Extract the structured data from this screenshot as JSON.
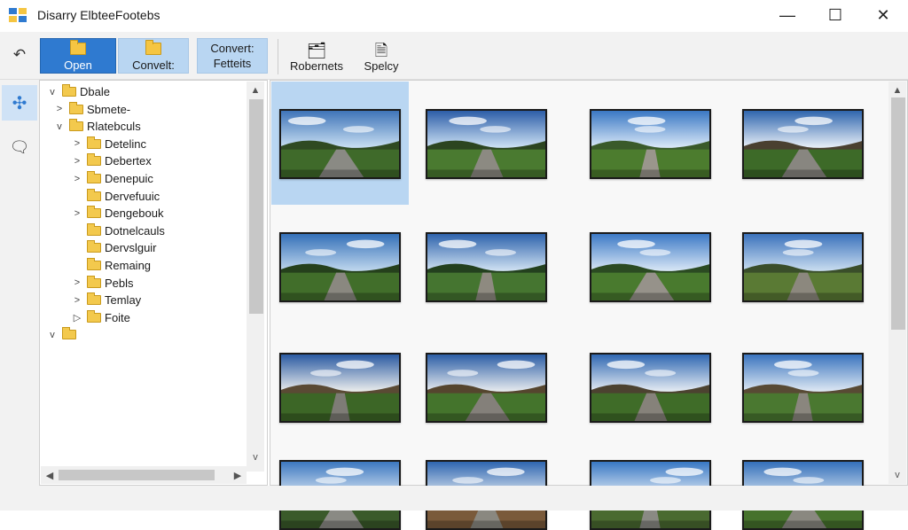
{
  "window": {
    "title": "Disarry ElbteeFootebs",
    "minimize_glyph": "—",
    "maximize_glyph": "☐",
    "close_glyph": "✕"
  },
  "toolbar": {
    "back_icon": "↶",
    "open_label": "Open",
    "convert_label": "Convelt:",
    "convert_fetteis_line1": "Convert:",
    "convert_fetteis_line2": "Fetteits",
    "roberets_label": "Robernets",
    "spelcy_label": "Spelcy",
    "roberets_icon": "🗂",
    "spelcy_icon": "🗎"
  },
  "rail": {
    "pin_icon": "✣",
    "chat_icon": "🗨"
  },
  "tree": {
    "items": [
      {
        "label": "Dbale",
        "chevron": "v",
        "indent": 0
      },
      {
        "label": "Sbmete-",
        "chevron": ">",
        "indent": 1
      },
      {
        "label": "Rlatebculs",
        "chevron": "v",
        "indent": 1
      },
      {
        "label": "Detelinc",
        "chevron": ">",
        "indent": 2
      },
      {
        "label": "Debertex",
        "chevron": ">",
        "indent": 2
      },
      {
        "label": "Denepuic",
        "chevron": ">",
        "indent": 2
      },
      {
        "label": "Dervefuuic",
        "chevron": "",
        "indent": 2
      },
      {
        "label": "Dengebouk",
        "chevron": ">",
        "indent": 2
      },
      {
        "label": "Dotnelcauls",
        "chevron": "",
        "indent": 2
      },
      {
        "label": "Dervslguir",
        "chevron": "",
        "indent": 2
      },
      {
        "label": "Remaing",
        "chevron": "",
        "indent": 2
      },
      {
        "label": "Pebls",
        "chevron": ">",
        "indent": 2
      },
      {
        "label": "Temlay",
        "chevron": ">",
        "indent": 2
      },
      {
        "label": "Foite",
        "chevron": "▷",
        "indent": 2
      },
      {
        "label": "",
        "chevron": "v",
        "indent": 0
      }
    ],
    "scroll_up": "▲",
    "scroll_down": "v",
    "scroll_left": "◀",
    "scroll_right": "▶"
  },
  "gallery": {
    "thumbnails": [
      {
        "sky": "#3f74b8",
        "horizon": "#cfe4f5",
        "ground": "#3f6a2a",
        "hill": "#2f4a22",
        "road": "#8a8a84"
      },
      {
        "sky": "#2d5ea8",
        "horizon": "#d5e8f8",
        "ground": "#4a7a30",
        "hill": "#2c4520",
        "road": "#8c8a82"
      },
      {
        "sky": "#3a78c4",
        "horizon": "#e2eefa",
        "ground": "#4c7c2e",
        "hill": "#3a5a2a",
        "road": "#9a968c"
      },
      {
        "sky": "#2f66ae",
        "horizon": "#f2f6fb",
        "ground": "#3d6a28",
        "hill": "#4a4030",
        "road": "#888680"
      },
      {
        "sky": "#3470b8",
        "horizon": "#c6dcf0",
        "ground": "#416e2a",
        "hill": "#25401c",
        "road": "#8a8880"
      },
      {
        "sky": "#2e63ac",
        "horizon": "#d8e8f6",
        "ground": "#457530",
        "hill": "#23401e",
        "road": "#8e8a80"
      },
      {
        "sky": "#3d7ac6",
        "horizon": "#e0ecf8",
        "ground": "#497a2e",
        "hill": "#2b4a22",
        "road": "#96928a"
      },
      {
        "sky": "#3b72bc",
        "horizon": "#d0e2f2",
        "ground": "#5a7a34",
        "hill": "#3a4e2a",
        "road": "#8c887e"
      },
      {
        "sky": "#2a5aa2",
        "horizon": "#f4f4f0",
        "ground": "#3c6626",
        "hill": "#5a4a34",
        "road": "#7e7c76"
      },
      {
        "sky": "#2c5ea6",
        "horizon": "#f0f2f2",
        "ground": "#44742c",
        "hill": "#55452e",
        "road": "#84807a"
      },
      {
        "sky": "#3068b2",
        "horizon": "#eef2f6",
        "ground": "#3f6c28",
        "hill": "#4c4230",
        "road": "#86827a"
      },
      {
        "sky": "#3a74be",
        "horizon": "#e6eef6",
        "ground": "#4a7830",
        "hill": "#584a34",
        "road": "#8a867e"
      },
      {
        "sky": "#3c78c0",
        "horizon": "#e8f0f8",
        "ground": "#3a5a2a",
        "hill": "#4a5a3a",
        "road": "#8a8a84"
      },
      {
        "sky": "#2e66b0",
        "horizon": "#f0f4f8",
        "ground": "#7a5a3a",
        "hill": "#6a4a30",
        "road": "#8a8880"
      },
      {
        "sky": "#3878c4",
        "horizon": "#f2f6fa",
        "ground": "#4a6a30",
        "hill": "#3a5228",
        "road": "#8a8a84"
      },
      {
        "sky": "#3470ba",
        "horizon": "#dce8f4",
        "ground": "#46722c",
        "hill": "#2e4822",
        "road": "#8a8880"
      }
    ],
    "scroll_up": "▲",
    "scroll_down": "v"
  }
}
